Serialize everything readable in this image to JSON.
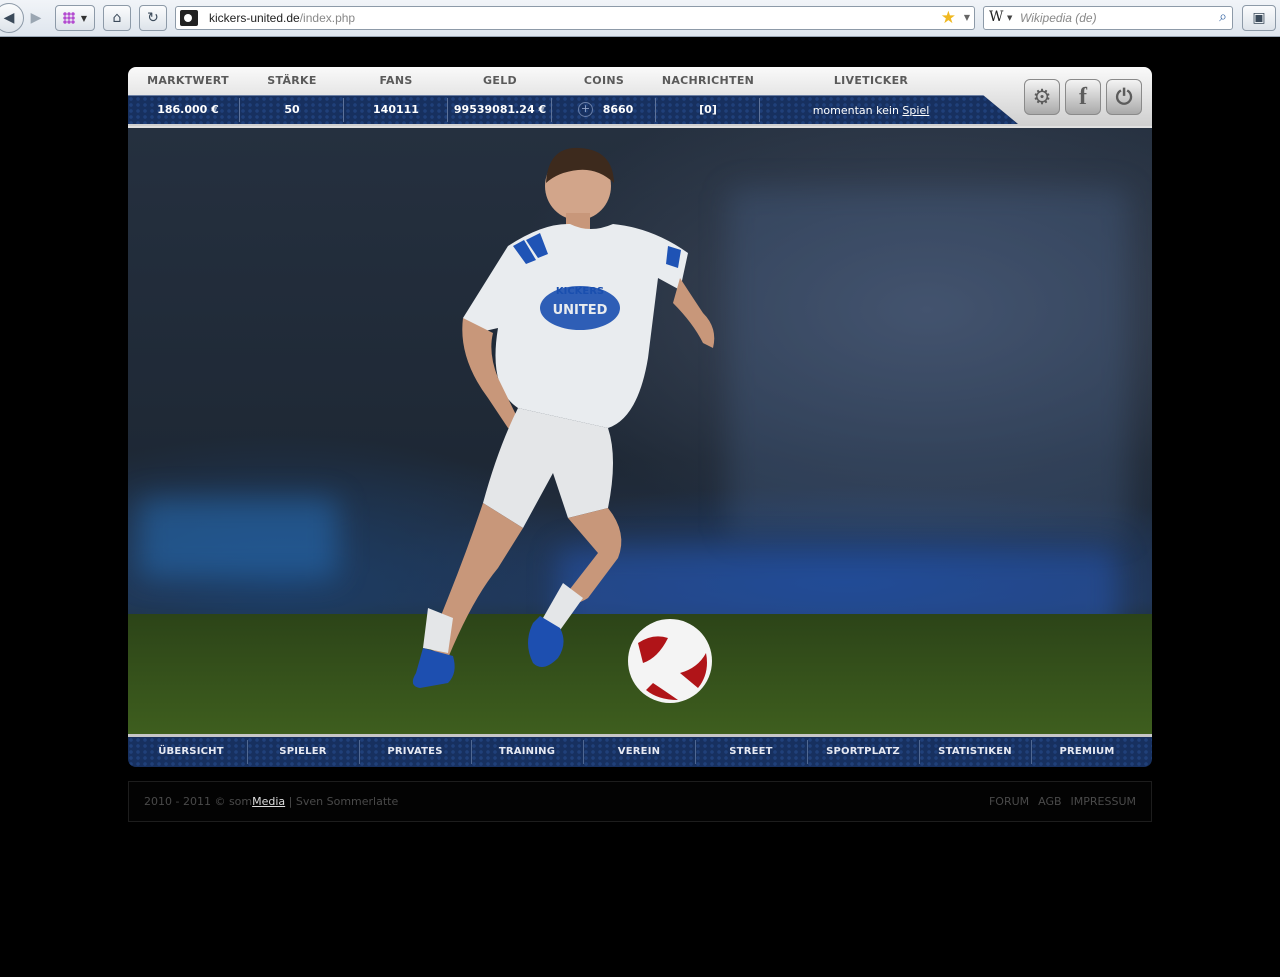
{
  "browser": {
    "url_host": "kickers-united.de",
    "url_path": "/index.php",
    "search_placeholder": "Wikipedia (de)",
    "search_engine_icon": "W"
  },
  "stats": {
    "labels": [
      "MARKTWERT",
      "STÄRKE",
      "FANS",
      "GELD",
      "COINS",
      "NACHRICHTEN",
      "LIVETICKER"
    ],
    "marktwert": "186.000 €",
    "staerke": "50",
    "fans": "140111",
    "geld": "99539081.24 €",
    "coins": "8660",
    "nachrichten": "[0]",
    "liveticker_prefix": "momentan kein",
    "liveticker_link": "Spiel"
  },
  "icons": {
    "settings": "⚙",
    "facebook": "f",
    "power": "⏻",
    "coin_add": "+"
  },
  "nav": [
    "ÜBERSICHT",
    "SPIELER",
    "PRIVATES",
    "TRAINING",
    "VEREIN",
    "STREET",
    "SPORTPLATZ",
    "STATISTIKEN",
    "PREMIUM"
  ],
  "footer": {
    "copyright_prefix": "2010 - 2011 © som",
    "media_link": "Media",
    "author": "| Sven Sommerlatte",
    "links": [
      "FORUM",
      "AGB",
      "IMPRESSUM"
    ]
  },
  "jersey_text": [
    "KICKERS",
    "UNITED"
  ]
}
